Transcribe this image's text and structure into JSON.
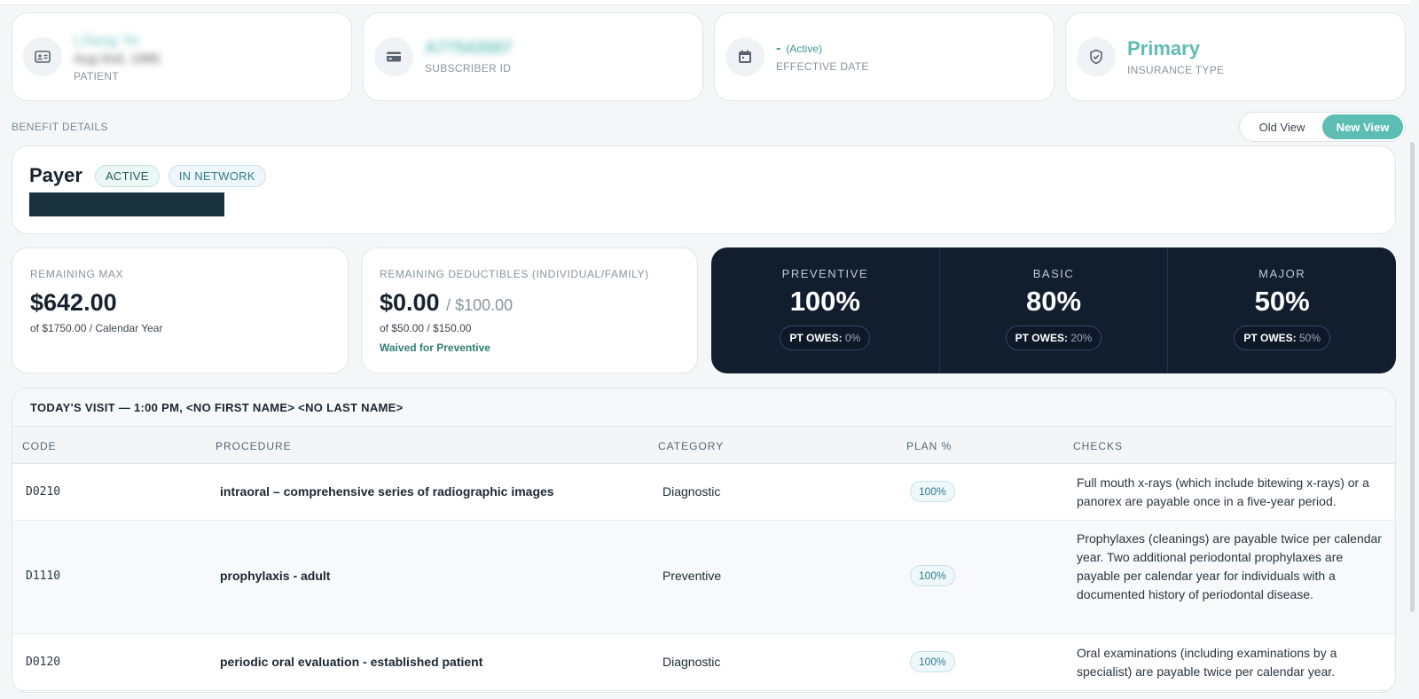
{
  "patient": {
    "name": "Lifang Ye",
    "dob": "Aug 0nd, 1985",
    "label": "PATIENT"
  },
  "subscriber": {
    "id": "A77543587",
    "label": "SUBSCRIBER ID"
  },
  "effective": {
    "value": "-",
    "status": "(Active)",
    "label": "EFFECTIVE DATE"
  },
  "insurance": {
    "type": "Primary",
    "label": "INSURANCE TYPE"
  },
  "benefit_label": "BENEFIT DETAILS",
  "view_toggle": {
    "old": "Old View",
    "new": "New View"
  },
  "payer": {
    "title": "Payer",
    "badge_active": "ACTIVE",
    "badge_network": "IN NETWORK"
  },
  "remaining_max": {
    "label": "REMAINING MAX",
    "value": "$642.00",
    "sub": "of $1750.00 / Calendar Year"
  },
  "deductibles": {
    "label": "REMAINING DEDUCTIBLES (INDIVIDUAL/FAMILY)",
    "value": "$0.00",
    "family": "/ $100.00",
    "sub": "of $50.00 / $150.00",
    "note": "Waived for Preventive"
  },
  "coverage": [
    {
      "name": "PREVENTIVE",
      "pct": "100%",
      "owes_label": "PT OWES:",
      "owes": "0%"
    },
    {
      "name": "BASIC",
      "pct": "80%",
      "owes_label": "PT OWES:",
      "owes": "20%"
    },
    {
      "name": "MAJOR",
      "pct": "50%",
      "owes_label": "PT OWES:",
      "owes": "50%"
    }
  ],
  "visit": {
    "title": "TODAY'S VISIT — 1:00 PM, <NO FIRST NAME> <NO LAST NAME>",
    "columns": {
      "code": "CODE",
      "procedure": "PROCEDURE",
      "category": "CATEGORY",
      "plan": "PLAN %",
      "checks": "CHECKS"
    },
    "rows": [
      {
        "code": "D0210",
        "procedure": "intraoral – comprehensive series of radiographic images",
        "category": "Diagnostic",
        "plan": "100%",
        "checks": "Full mouth x-rays (which include bitewing x-rays) or a panorex are payable once in a five-year period."
      },
      {
        "code": "D1110",
        "procedure": "prophylaxis - adult",
        "category": "Preventive",
        "plan": "100%",
        "checks": "Prophylaxes (cleanings) are payable twice per calendar year. Two additional periodontal prophylaxes are payable per calendar year for individuals with a documented history of periodontal disease."
      },
      {
        "code": "D0120",
        "procedure": "periodic oral evaluation - established patient",
        "category": "Diagnostic",
        "plan": "100%",
        "checks": "Oral examinations (including examinations by a specialist) are payable twice per calendar year."
      }
    ]
  }
}
